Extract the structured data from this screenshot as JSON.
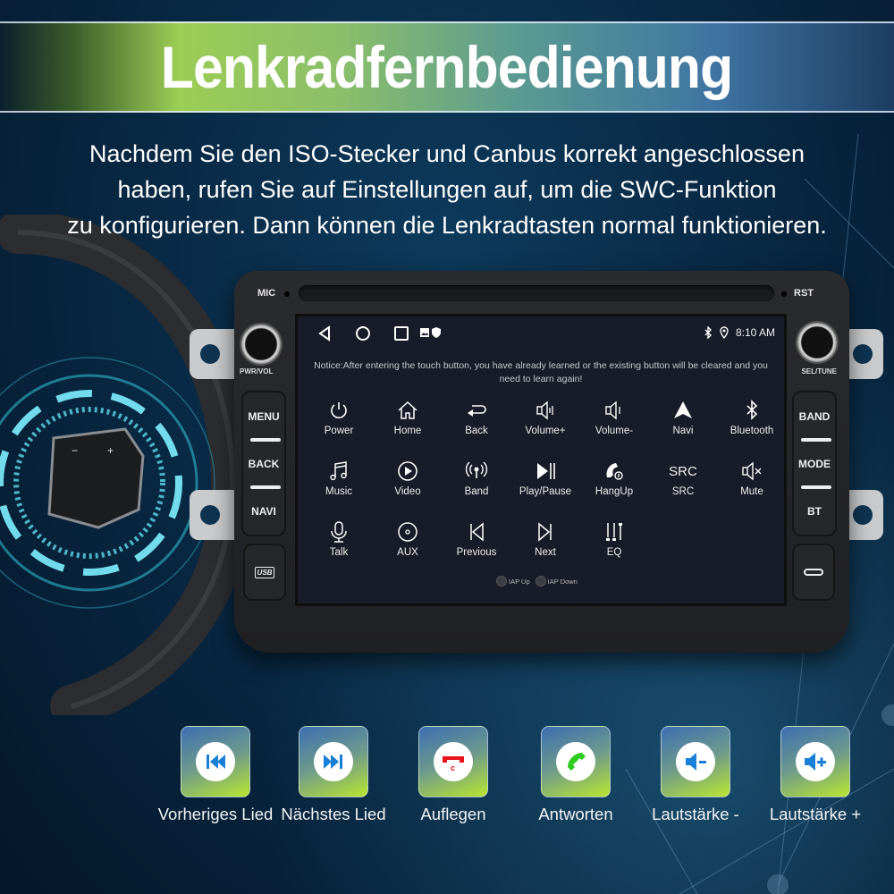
{
  "banner": {
    "title": "Lenkradfernbedienung"
  },
  "intro": {
    "lines": [
      "Nachdem Sie den ISO-Stecker und Canbus korrekt angeschlossen",
      "haben, rufen Sie auf Einstellungen auf, um die SWC-Funktion",
      "zu konfigurieren. Dann können die Lenkradtasten normal funktionieren."
    ]
  },
  "head_unit": {
    "mic_label": "MIC",
    "rst_label": "RST",
    "left_knob_label": "PWR/VOL",
    "right_knob_label": "SEL/TUNE",
    "left_buttons": [
      "MENU",
      "BACK",
      "NAVI"
    ],
    "right_buttons": [
      "BAND",
      "MODE",
      "BT"
    ],
    "usb_label": "USB",
    "screen": {
      "status_bar": {
        "nav_icons": [
          "back-triangle-icon",
          "home-circle-icon",
          "recents-square-icon",
          "image-notification-icon",
          "shield-notification-icon"
        ],
        "status_icons": [
          "bluetooth-icon",
          "location-icon"
        ],
        "time": "8:10 AM"
      },
      "notice": "Notice:After entering the touch button, you have already learned or the existing button will be cleared and you need to learn again!",
      "functions": [
        {
          "label": "Power",
          "icon": "power-icon"
        },
        {
          "label": "Home",
          "icon": "home-icon"
        },
        {
          "label": "Back",
          "icon": "return-arrow-icon"
        },
        {
          "label": "Volume+",
          "icon": "volume-up-icon"
        },
        {
          "label": "Volume-",
          "icon": "volume-down-icon"
        },
        {
          "label": "Navi",
          "icon": "navigation-arrow-icon"
        },
        {
          "label": "Bluetooth",
          "icon": "bluetooth-icon"
        },
        {
          "label": "Music",
          "icon": "music-note-icon"
        },
        {
          "label": "Video",
          "icon": "play-circle-icon"
        },
        {
          "label": "Band",
          "icon": "radio-antenna-icon"
        },
        {
          "label": "Play/Pause",
          "icon": "play-pause-icon"
        },
        {
          "label": "HangUp",
          "icon": "hangup-phone-icon"
        },
        {
          "label": "SRC",
          "icon": "src-text-icon",
          "glyph": "SRC"
        },
        {
          "label": "Mute",
          "icon": "mute-icon"
        },
        {
          "label": "Talk",
          "icon": "microphone-icon"
        },
        {
          "label": "AUX",
          "icon": "aux-disc-icon"
        },
        {
          "label": "Previous",
          "icon": "skip-previous-icon"
        },
        {
          "label": "Next",
          "icon": "skip-next-icon"
        },
        {
          "label": "EQ",
          "icon": "equalizer-icon"
        }
      ],
      "iap": [
        "IAP Up",
        "IAP Down"
      ]
    }
  },
  "tiles": [
    {
      "label": "Vorheriges Lied",
      "icon": "previous-track-icon",
      "color": "#1a7fd6"
    },
    {
      "label": "Nächstes Lied",
      "icon": "next-track-icon",
      "color": "#1a7fd6"
    },
    {
      "label": "Auflegen",
      "icon": "hang-up-icon",
      "color": "#e8141b"
    },
    {
      "label": "Antworten",
      "icon": "answer-call-icon",
      "color": "#2ecc1f"
    },
    {
      "label": "Lautstärke -",
      "icon": "volume-minus-icon",
      "color": "#1a7fd6"
    },
    {
      "label": "Lautstärke +",
      "icon": "volume-plus-icon",
      "color": "#1a7fd6"
    }
  ]
}
